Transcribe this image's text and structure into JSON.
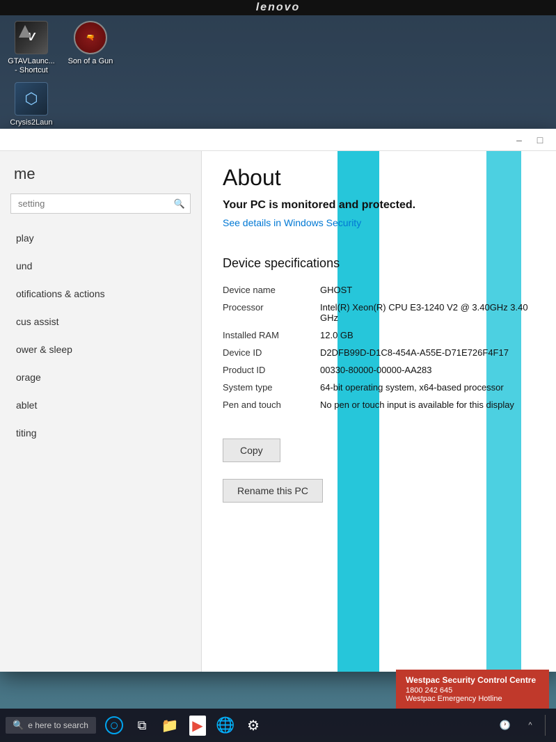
{
  "lenovo": {
    "brand": "lenovo"
  },
  "desktop": {
    "icons": [
      {
        "id": "gtav",
        "label": "GTAVLaunc... - Shortcut",
        "type": "gtav"
      },
      {
        "id": "son-of-a-gun",
        "label": "Son of a Gun",
        "type": "son"
      },
      {
        "id": "crysis2",
        "label": "Crysis2Laun",
        "type": "crysis"
      }
    ]
  },
  "window": {
    "titlebar": {
      "minimize_label": "–",
      "maximize_label": "□"
    }
  },
  "sidebar": {
    "title": "me",
    "search_placeholder": "setting",
    "nav_items": [
      {
        "label": "play"
      },
      {
        "label": "und"
      },
      {
        "label": "otifications & actions"
      },
      {
        "label": "cus assist"
      },
      {
        "label": "ower & sleep"
      },
      {
        "label": "orage"
      },
      {
        "label": "ablet"
      },
      {
        "label": "titing"
      }
    ]
  },
  "about": {
    "title": "About",
    "protection_text": "Your PC is monitored and protected.",
    "security_link": "See details in Windows Security",
    "device_specs_title": "Device specifications",
    "specs": [
      {
        "label": "Device name",
        "value": "GHOST"
      },
      {
        "label": "Processor",
        "value": "Intel(R) Xeon(R) CPU E3-1240 V2 @ 3.40GHz  3.40 GHz"
      },
      {
        "label": "Installed RAM",
        "value": "12.0 GB"
      },
      {
        "label": "Device ID",
        "value": "D2DFB99D-D1C8-454A-A55E-D71E726F4F17"
      },
      {
        "label": "Product ID",
        "value": "00330-80000-00000-AA283"
      },
      {
        "label": "System type",
        "value": "64-bit operating system, x64-based processor"
      },
      {
        "label": "Pen and touch",
        "value": "No pen or touch input is available for this display"
      }
    ],
    "copy_button": "Copy",
    "rename_button": "Rename this PC"
  },
  "taskbar": {
    "search_placeholder": "e here to search",
    "icons": [
      {
        "name": "start-button",
        "symbol": "⊞"
      },
      {
        "name": "cortana",
        "symbol": "○"
      },
      {
        "name": "task-view",
        "symbol": "⧉"
      },
      {
        "name": "file-explorer",
        "symbol": "🗂"
      },
      {
        "name": "media-player",
        "symbol": "▶"
      },
      {
        "name": "chrome",
        "symbol": "◉"
      },
      {
        "name": "settings",
        "symbol": "⚙"
      }
    ],
    "right_icons": [
      {
        "name": "show-desktop",
        "symbol": "⬜"
      },
      {
        "name": "chevron-up",
        "symbol": "^"
      }
    ]
  },
  "notification": {
    "title": "Westpac Security Control Centre",
    "phone": "1800 242 645",
    "subtitle": "Westpac Emergency Hotline"
  }
}
